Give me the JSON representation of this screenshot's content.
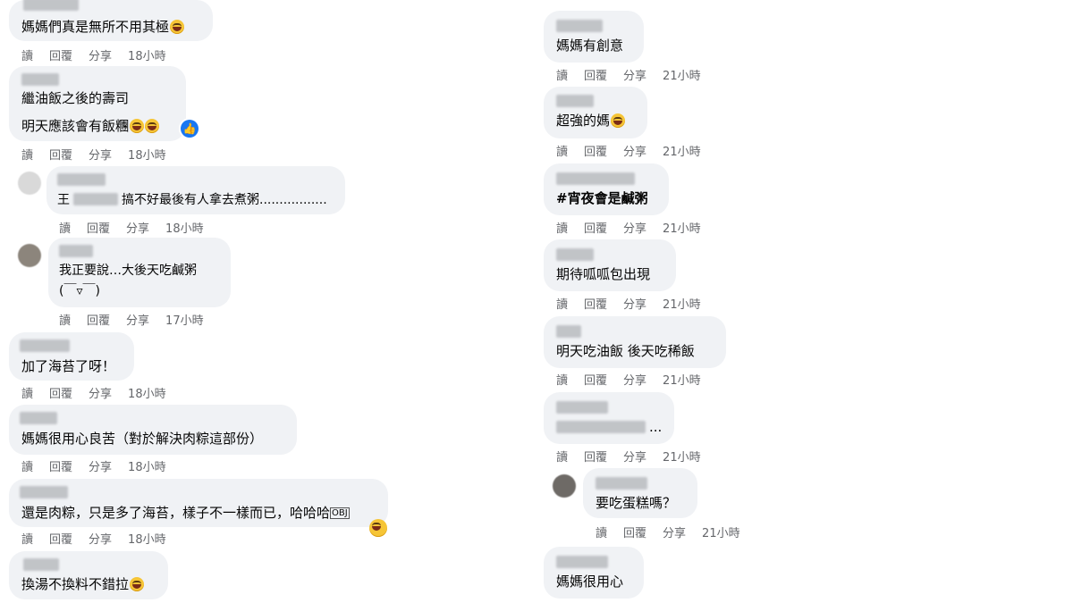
{
  "actions": {
    "read": "讀",
    "reply": "回覆",
    "share": "分享"
  },
  "left": [
    {
      "text": "媽媽們真是無所不用其極",
      "emoji": true,
      "time": "18小時"
    },
    {
      "line1": "繼油飯之後的壽司",
      "line2": "明天應該會有飯糰",
      "emoji_count": 2,
      "time": "18小時"
    },
    {
      "text_prefix": "王",
      "text": "搞不好最後有人拿去煮粥.................",
      "time": "18小時"
    },
    {
      "line1": "我正要說…大後天吃鹹粥",
      "line2": "(￣▿￣)",
      "time": "17小時"
    },
    {
      "text": "加了海苔了呀！",
      "time": "18小時"
    },
    {
      "text": "媽媽很用心良苦（對於解決肉粽這部份）",
      "time": "18小時"
    },
    {
      "text": "還是肉粽，只是多了海苔，樣子不一樣而已，哈哈哈",
      "ellipsis_box": "OBJ",
      "time": "18小時"
    },
    {
      "text": "換湯不換料不錯拉",
      "emoji": true
    }
  ],
  "right": [
    {
      "text": "媽媽有創意",
      "time": "21小時"
    },
    {
      "text": "超強的媽",
      "emoji": true,
      "time": "21小時"
    },
    {
      "text": "#宵夜會是鹹粥",
      "time": "21小時"
    },
    {
      "text": "期待呱呱包出現",
      "time": "21小時"
    },
    {
      "text": "明天吃油飯 後天吃稀飯",
      "time": "21小時"
    },
    {
      "text": "...",
      "time": "21小時"
    },
    {
      "text": "要吃蛋糕嗎？",
      "time": "21小時"
    },
    {
      "text": "媽媽很用心"
    }
  ],
  "icons": {
    "like": "thumbs-up-icon",
    "laugh": "laughing-emoji-icon"
  },
  "colors": {
    "bubble": "#f0f2f5",
    "meta": "#65676b",
    "like": "#1877f2"
  }
}
